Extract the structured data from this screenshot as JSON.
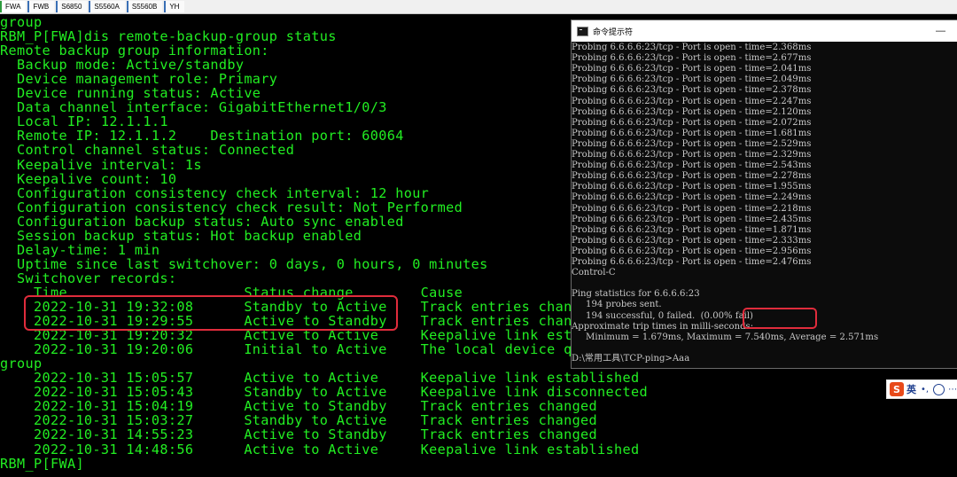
{
  "tabs": [
    "FWA",
    "FWB",
    "S6850",
    "S5560A",
    "S5560B",
    "YH"
  ],
  "terminal_lines": [
    "group",
    "RBM_P[FWA]dis remote-backup-group status",
    "Remote backup group information:",
    "  Backup mode: Active/standby",
    "  Device management role: Primary",
    "  Device running status: Active",
    "  Data channel interface: GigabitEthernet1/0/3",
    "  Local IP: 12.1.1.1",
    "  Remote IP: 12.1.1.2    Destination port: 60064",
    "  Control channel status: Connected",
    "  Keepalive interval: 1s",
    "  Keepalive count: 10",
    "  Configuration consistency check interval: 12 hour",
    "  Configuration consistency check result: Not Performed",
    "  Configuration backup status: Auto sync enabled",
    "  Session backup status: Hot backup enabled",
    "  Delay-time: 1 min",
    "  Uptime since last switchover: 0 days, 0 hours, 0 minutes",
    "  Switchover records:",
    "    Time                     Status change        Cause",
    "    2022-10-31 19:32:08      Standby to Active    Track entries chan",
    "    2022-10-31 19:29:55      Active to Standby    Track entries chan",
    "    2022-10-31 19:20:32      Active to Active     Keepalive link est",
    "    2022-10-31 19:20:06      Initial to Active    The local device q",
    "group",
    "    2022-10-31 15:05:57      Active to Active     Keepalive link established",
    "    2022-10-31 15:05:43      Standby to Active    Keepalive link disconnected",
    "    2022-10-31 15:04:19      Active to Standby    Track entries changed",
    "    2022-10-31 15:03:27      Standby to Active    Track entries changed",
    "    2022-10-31 14:55:23      Active to Standby    Track entries changed",
    "    2022-10-31 14:48:56      Active to Active     Keepalive link established",
    "RBM_P[FWA]"
  ],
  "cmd_window": {
    "title": "命令提示符",
    "minimize_glyph": "—",
    "lines": [
      "Probing 6.6.6.6:23/tcp - Port is open - time=2.368ms",
      "Probing 6.6.6.6:23/tcp - Port is open - time=2.677ms",
      "Probing 6.6.6.6:23/tcp - Port is open - time=2.041ms",
      "Probing 6.6.6.6:23/tcp - Port is open - time=2.049ms",
      "Probing 6.6.6.6:23/tcp - Port is open - time=2.378ms",
      "Probing 6.6.6.6:23/tcp - Port is open - time=2.247ms",
      "Probing 6.6.6.6:23/tcp - Port is open - time=2.120ms",
      "Probing 6.6.6.6:23/tcp - Port is open - time=2.072ms",
      "Probing 6.6.6.6:23/tcp - Port is open - time=1.681ms",
      "Probing 6.6.6.6:23/tcp - Port is open - time=2.529ms",
      "Probing 6.6.6.6:23/tcp - Port is open - time=2.329ms",
      "Probing 6.6.6.6:23/tcp - Port is open - time=2.543ms",
      "Probing 6.6.6.6:23/tcp - Port is open - time=2.278ms",
      "Probing 6.6.6.6:23/tcp - Port is open - time=1.955ms",
      "Probing 6.6.6.6:23/tcp - Port is open - time=2.249ms",
      "Probing 6.6.6.6:23/tcp - Port is open - time=2.218ms",
      "Probing 6.6.6.6:23/tcp - Port is open - time=2.435ms",
      "Probing 6.6.6.6:23/tcp - Port is open - time=1.871ms",
      "Probing 6.6.6.6:23/tcp - Port is open - time=2.333ms",
      "Probing 6.6.6.6:23/tcp - Port is open - time=2.956ms",
      "Probing 6.6.6.6:23/tcp - Port is open - time=2.476ms",
      "Control-C",
      "",
      "Ping statistics for 6.6.6.6:23",
      "     194 probes sent.",
      "     194 successful, 0 failed.  (0.00% fail)",
      "Approximate trip times in milli-seconds:",
      "     Minimum = 1.679ms, Maximum = 7.540ms, Average = 2.571ms",
      "",
      "D:\\常用工具\\TCP-ping>Aaa"
    ]
  },
  "ime": {
    "logo": "S",
    "mode": "英",
    "punctuation": "•,",
    "more": "⋯"
  },
  "colors": {
    "terminal_text": "#22ee22",
    "highlight": "#e02c3c",
    "cmd_text": "#c8c8c8"
  }
}
